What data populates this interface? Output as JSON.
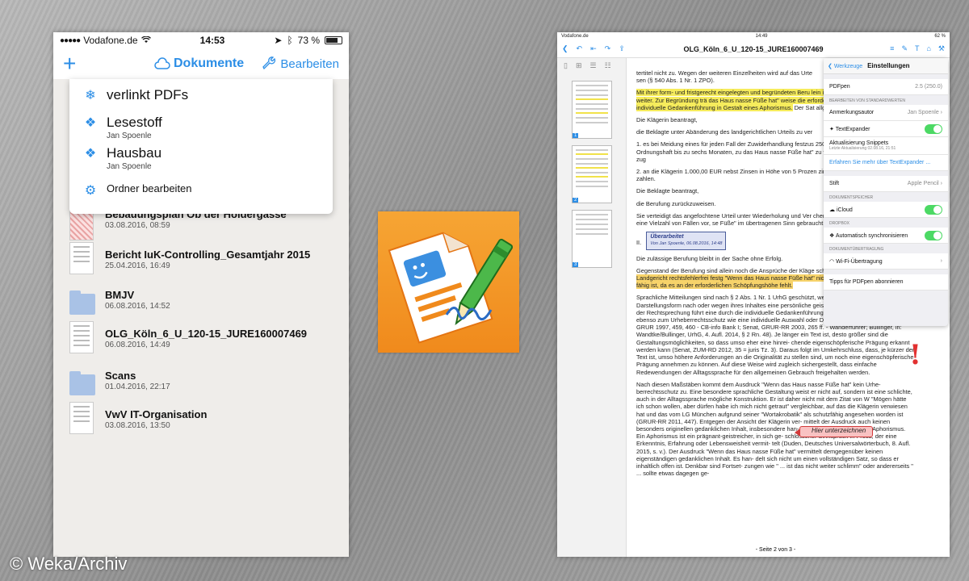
{
  "watermark": "© Weka/Archiv",
  "phone": {
    "statusbar": {
      "carrier": "Vodafone.de",
      "time": "14:53",
      "battery": "73 %"
    },
    "navbar": {
      "plus": "+",
      "title": "Dokumente",
      "edit": "Bearbeiten"
    },
    "dropdown": [
      {
        "icon": "snowflake-icon",
        "title": "verlinkt PDFs",
        "sub": ""
      },
      {
        "icon": "dropbox-icon",
        "title": "Lesestoff",
        "sub": "Jan Spoenle"
      },
      {
        "icon": "dropbox-icon",
        "title": "Hausbau",
        "sub": "Jan Spoenle"
      },
      {
        "icon": "gear-icon",
        "title": "Ordner bearbeiten",
        "sub": ""
      }
    ],
    "files": [
      {
        "name": "Bebauungsplan Ob der Holdergasse",
        "date": "03.08.2016, 08:59",
        "kind": "plan"
      },
      {
        "name": "Bericht IuK-Controlling_Gesamtjahr 2015",
        "date": "25.04.2016, 16:49",
        "kind": "doc"
      },
      {
        "name": "BMJV",
        "date": "06.08.2016, 14:52",
        "kind": "folder"
      },
      {
        "name": "OLG_Köln_6_U_120-15_JURE160007469",
        "date": "06.08.2016, 14:49",
        "kind": "doc"
      },
      {
        "name": "Scans",
        "date": "01.04.2016, 22:17",
        "kind": "folder"
      },
      {
        "name": "VwV IT-Organisation",
        "date": "03.08.2016, 13:50",
        "kind": "doc"
      }
    ]
  },
  "ipad": {
    "statusbar": {
      "carrier": "Vodafone.de",
      "time": "14:49",
      "battery": "62 %"
    },
    "title": "OLG_Köln_6_U_120-15_JURE160007469",
    "page_numbers": [
      "1",
      "2",
      "3"
    ],
    "page_footer": "- Seite 2 von 3 -",
    "stamp": {
      "title": "Überarbeitet",
      "sub": "Von Jan Spoenle, 06.08.2016, 14:48"
    },
    "callout": "Hier unterzeichnen",
    "exclaim": "!",
    "popover": {
      "back": "Werkzeuge",
      "title": "Einstellungen",
      "pdfpen_label": "PDFpen",
      "pdfpen_value": "2.5 (250.0)",
      "sec_defaults": "BEARBEITEN VON STANDARDWERTEN",
      "author_label": "Anmerkungsautor",
      "author_value": "Jan Spoenle",
      "textexpander": "TextExpander",
      "snippets_title": "Aktualisierung Snippets",
      "snippets_sub": "Letzte Aktualisierung 02.08.16, 21:51",
      "te_link": "Erfahren Sie mehr über TextExpander ...",
      "pen_label": "Stift",
      "pen_value": "Apple Pencil",
      "sec_storage": "DOKUMENTSPEICHER",
      "icloud": "iCloud",
      "sec_dropbox": "DROPBOX",
      "autosync": "Automatisch synchronisieren",
      "sec_transfer": "DOKUMENTÜBERTRAGUNG",
      "wifi": "Wi-Fi-Übertragung",
      "tips": "Tipps für PDFpen abonnieren"
    },
    "doc": {
      "p1": "tertitel nicht zu. Wegen der weiteren Einzelheiten wird auf das Urte",
      "p1b": "sen (§ 540 Abs. 1 Nr. 1 ZPO).",
      "p2_hl": "Mit ihrer form- und fristgerecht eingelegten und begründeten Beru lein ihre urheberrechtlichen Ansprüche weiter. Zur Begründung trä das Haus nasse Füße hat\" weise die erforderliche Schöpfungshöhe individuelle Gedankenführung in Gestalt eines Aphorismus.",
      "p2_tail": "Der Sat allgemeinen Sprachgebrauch.",
      "p3": "Die Klägerin beantragt,",
      "p4": "die Beklagte unter Abänderung des landgerichtlichen Urteils zu ver",
      "p5": "1. es bei Meidung eines für jeden Fall der Zuwiderhandlung festzus 250.000 EUR, ersatzweise Ordnungshaft bis zu sechs Monaten, zu das Haus nasse Füße hat\" zu vervielfältigen und/oder öffentlich zug",
      "p6": "2. an die Klägerin 1.000,00 EUR nebst Zinsen in Höhe von 5 Prozen zinssatz seit Rechtshängigkeit zu zahlen.",
      "p7": "Die Beklagte beantragt,",
      "p8": "die Berufung zurückzuweisen.",
      "p9": "Sie verteidigt das angefochtene Urteil unter Wiederholung und Ver chen Vortrags. Insbesondere trägt sie eine Vielzahl von Fällen vor, se Füße\" im übertragenen Sinn gebraucht wird.",
      "p10_num": "II.",
      "p11": "Die zulässige Berufung bleibt in der Sache ohne Erfolg.",
      "p12_a": "Gegenstand der Berufung sind allein noch die Ansprüche der Kläge scheitern jedoch daran, dass",
      "p12_hl": "das Landgericht rechtsfehlerfrei festg \"Wenn das Haus nasse Füße hat\" nicht als Sprachwerk im Sinn des fähig ist, da es an der erforderlichen Schöpfungshöhe fehlt.",
      "p13": "Sprachliche Mitteilungen sind nach § 2 Abs. 1 Nr. 1 UrhG geschützt, wenn sie entweder ihrer Darstellungsform nach oder wegen ihres Inhaltes eine persönliche geistige Schöpfung beinhal- ten. Nach der Rechtsprechung führt eine durch die individuelle Gedankenführung geprägte sprachliche Gestaltung ebenso zum Urheberrechtsschutz wie eine individuelle Auswahl oder Darstellung des Inhalts (BGH, GRUR 1997, 459, 460 - CB-info Bank I; Senat, GRUR-RR 2003, 265 ff. - Wanderführer; Bullinger, in: Wandtke/Bullinger, UrhG, 4. Aufl. 2014, § 2 Rn. 48). Je länger ein Text ist, desto größer sind die Gestaltungsmöglichkeiten, so dass umso eher eine hinrei- chende eigenschöpferische Prägung erkannt werden kann (Senat, ZUM-RD 2012, 35 = juris Tz. 3). Daraus folgt im Umkehrschluss, dass, je kürzer der Text ist, umso höhere Anforderungen an die Originalität zu stellen sind, um noch eine eigenschöpferische Prägung annehmen zu können. Auf diese Weise wird zugleich sichergestellt, dass einfache Redewendungen der Alltagssprache für den allgemeinen Gebrauch freigehalten werden.",
      "p14": "Nach diesen Maßstäben kommt dem Ausdruck \"Wenn das Haus nasse Füße hat\" kein Urhe- berrechtsschutz zu. Eine besondere sprachliche Gestaltung weist er nicht auf, sondern ist eine schlichte, auch in der Alltagssprache mögliche Konstruktion. Er ist daher nicht mit dem Zitat von W \"Mögen hätte ich schon wollen, aber dürfen habe ich mich nicht getraut\" vergleichbar, auf das die Klägerin verwiesen hat und das vom LG München aufgrund seiner \"Wortakrobatik\" als schutzfähig angesehen worden ist (GRUR-RR 2011, 447). Entgegen der Ansicht der Klägerin ver- mittelt der Ausdruck auch keinen besonders originellen gedanklichen Inhalt, insbesondere han- delt es sich nicht um einen Aphorismus. Ein Aphorismus ist ein prägnant-geistreicher, in sich ge- schlossener Sinnspruch in Prosa, der eine Erkenntnis, Erfahrung oder Lebensweisheit vermit- telt (Duden, Deutsches Universalwörterbuch, 8. Aufl. 2015, s. v.). Der Ausdruck \"Wenn das Haus nasse Füße hat\" vermittelt demgegenüber keinen eigenständigen gedanklichen Inhalt. Es han- delt sich nicht um einen vollständigen Satz, so dass er inhaltlich offen ist. Denkbar sind Fortset- zungen wie \" ... ist das nicht weiter schlimm\" oder andererseits \" ... sollte etwas dagegen ge-"
    }
  }
}
